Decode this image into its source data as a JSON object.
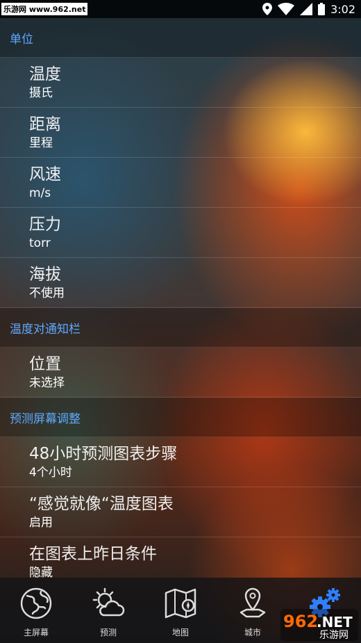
{
  "status": {
    "watermark_text": "乐游网 www.962.net",
    "time": "3:02"
  },
  "sections": [
    {
      "header": "单位",
      "items": [
        {
          "title": "温度",
          "value": "摄氏"
        },
        {
          "title": "距离",
          "value": "里程"
        },
        {
          "title": "风速",
          "value": "m/s"
        },
        {
          "title": "压力",
          "value": "torr"
        },
        {
          "title": "海拔",
          "value": "不使用"
        }
      ]
    },
    {
      "header": "温度对通知栏",
      "items": [
        {
          "title": "位置",
          "value": "未选择"
        }
      ]
    },
    {
      "header": "预测屏幕调整",
      "items": [
        {
          "title": "48小时预测图表步骤",
          "value": "4个小时"
        },
        {
          "title": "“感觉就像“温度图表",
          "value": "启用"
        },
        {
          "title": "在图表上昨日条件",
          "value": "隐藏"
        }
      ]
    }
  ],
  "nav": [
    {
      "label": "主屏幕",
      "icon": "globe-icon"
    },
    {
      "label": "预测",
      "icon": "sun-cloud-icon"
    },
    {
      "label": "地图",
      "icon": "map-icon"
    },
    {
      "label": "城市",
      "icon": "location-pin-icon"
    },
    {
      "label": "设置",
      "icon": "gears-icon"
    }
  ],
  "watermark": {
    "brand": "962",
    "suffix": ".NET",
    "cn": "乐游网"
  },
  "colors": {
    "section_header": "#5fa8ff",
    "active_nav": "#2f7fff"
  }
}
